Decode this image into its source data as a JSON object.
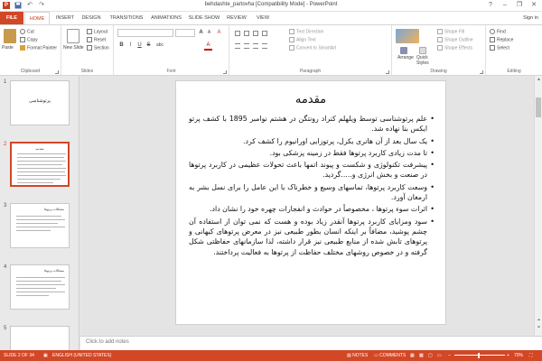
{
  "titlebar": {
    "title": "behdashte_partovha [Compatibility Mode] - PowerPoint",
    "app_badge": "P",
    "undo": "↶",
    "redo": "↷",
    "help": "?",
    "minimize": "–",
    "restore": "❐",
    "close": "✕"
  },
  "tabs": [
    {
      "label": "FILE"
    },
    {
      "label": "HOME"
    },
    {
      "label": "INSERT"
    },
    {
      "label": "DESIGN"
    },
    {
      "label": "TRANSITIONS"
    },
    {
      "label": "ANIMATIONS"
    },
    {
      "label": "SLIDE SHOW"
    },
    {
      "label": "REVIEW"
    },
    {
      "label": "VIEW"
    }
  ],
  "signin": "Sign in",
  "ribbon": {
    "clipboard": {
      "label": "Clipboard",
      "paste": "Paste",
      "cut": "Cut",
      "copy": "Copy",
      "format_painter": "Format Painter"
    },
    "slides": {
      "label": "Slides",
      "new_slide": "New Slide",
      "layout": "Layout",
      "reset": "Reset",
      "section": "Section"
    },
    "font": {
      "label": "Font",
      "bold": "B",
      "italic": "I",
      "underline": "U",
      "strike": "S",
      "shadow": "abc",
      "grow": "A",
      "shrink": "A",
      "clear": "A",
      "color": "A"
    },
    "paragraph": {
      "label": "Paragraph",
      "text_direction": "Text Direction",
      "align_text": "Align Text",
      "smartart": "Convert to SmartArt"
    },
    "drawing": {
      "label": "Drawing",
      "arrange": "Arrange",
      "quick_styles": "Quick Styles",
      "shape_fill": "Shape Fill",
      "shape_outline": "Shape Outline",
      "shape_effects": "Shape Effects"
    },
    "editing": {
      "label": "Editing",
      "find": "Find",
      "replace": "Replace",
      "select": "Select"
    }
  },
  "thumbnails": [
    {
      "num": "1",
      "title": "پرتوشناسی"
    },
    {
      "num": "2",
      "title": "مقدمه"
    },
    {
      "num": "3",
      "title": "مشکلات پرتوها"
    },
    {
      "num": "4",
      "title": "مشکلات پرتوها"
    },
    {
      "num": "5",
      "title": ""
    }
  ],
  "slide": {
    "title": "مقدمه",
    "bullets": [
      "علم پرتوشناسی توسط ویلهلم کنراد رونتگن در هشتم نوامبر 1895 با کشف پرتو ایکس بنا نهاده شد.",
      "یک سال بعد از آن هانری بکرل، پرتوزایی اورانیوم را کشف کرد.",
      "تا مدت زیادی کاربرد پرتوها فقط در زمینه پزشکی بود.",
      "پیشرفت تکنولوژی و شکست و پیوند اتمها باعث تحولات عظیمی در کاربرد پرتوها در صنعت و بخش انرژی و.....گردید.",
      "وسعت کاربرد پرتوها، تماسهای وسیع و خطرناک با این عامل را برای نسل بشر به ارمغان آورد.",
      "اثرات سوء پرتوها ، مخصوصاً در حوادث و انفجارات چهره خود را نشان داد.",
      "سود ومزایای کاربرد پرتوها آنقدر زیاد بوده و هست که نمی توان از استفاده آن چشم پوشید، مضافاً بر اینکه انسان بطور طبیعی نیز در معرض پرتوهای کیهانی و پرتوهای تابش شده از منابع طبیعی نیز قرار داشته، لذا سازمانهای حفاظتی شکل گرفته و در خصوص روشهای مختلف حفاظت از پرتوها به فعالیت پرداختند."
    ]
  },
  "notes_placeholder": "Click to add notes",
  "status": {
    "slide_info": "SLIDE 2 OF 34",
    "language": "ENGLISH (UNITED STATES)",
    "notes": "NOTES",
    "comments": "COMMENTS",
    "zoom": "70%"
  }
}
